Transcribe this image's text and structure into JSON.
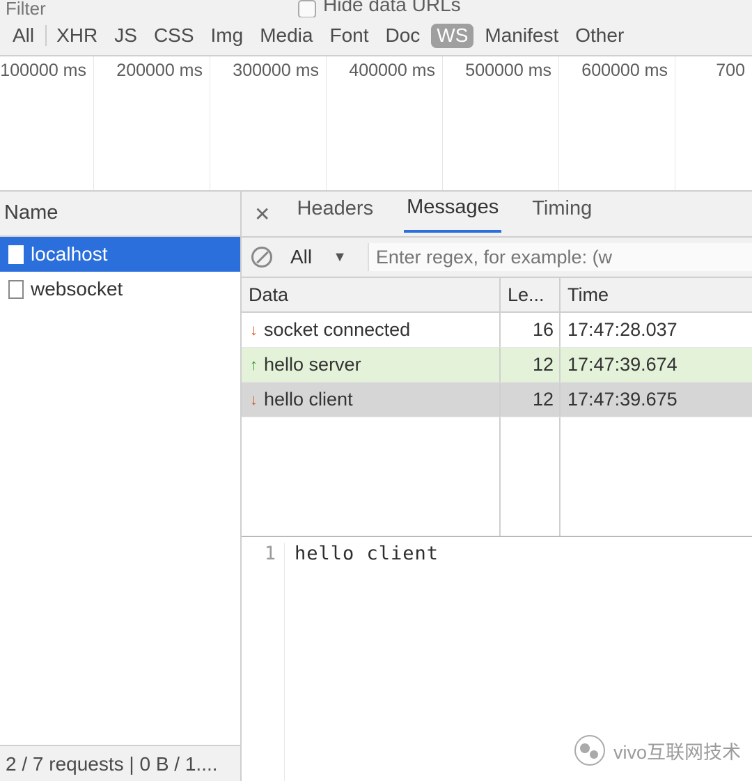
{
  "filterBar": {
    "placeholder": "Filter",
    "hideDataUrlsLabel": "Hide data URLs"
  },
  "typeTabs": {
    "items": [
      "All",
      "XHR",
      "JS",
      "CSS",
      "Img",
      "Media",
      "Font",
      "Doc",
      "WS",
      "Manifest",
      "Other"
    ],
    "selectedIndex": 8
  },
  "timeline": {
    "ticks": [
      "100000 ms",
      "200000 ms",
      "300000 ms",
      "400000 ms",
      "500000 ms",
      "600000 ms",
      "700"
    ]
  },
  "leftPanel": {
    "header": "Name",
    "items": [
      {
        "label": "localhost",
        "selected": true
      },
      {
        "label": "websocket",
        "selected": false
      }
    ],
    "status": "2 / 7 requests | 0 B / 1...."
  },
  "detailTabs": {
    "items": [
      "Headers",
      "Messages",
      "Timing"
    ],
    "activeIndex": 1
  },
  "wsFilter": {
    "dropdown": "All",
    "placeholder": "Enter regex, for example: (w"
  },
  "messages": {
    "headers": {
      "data": "Data",
      "len": "Le...",
      "time": "Time"
    },
    "rows": [
      {
        "dir": "down",
        "data": "socket connected",
        "len": "16",
        "time": "17:47:28.037",
        "sel": false
      },
      {
        "dir": "up",
        "data": "hello server",
        "len": "12",
        "time": "17:47:39.674",
        "sel": false
      },
      {
        "dir": "down",
        "data": "hello client",
        "len": "12",
        "time": "17:47:39.675",
        "sel": true
      }
    ]
  },
  "payload": {
    "line": "1",
    "text": "hello client"
  },
  "watermark": "vivo互联网技术"
}
